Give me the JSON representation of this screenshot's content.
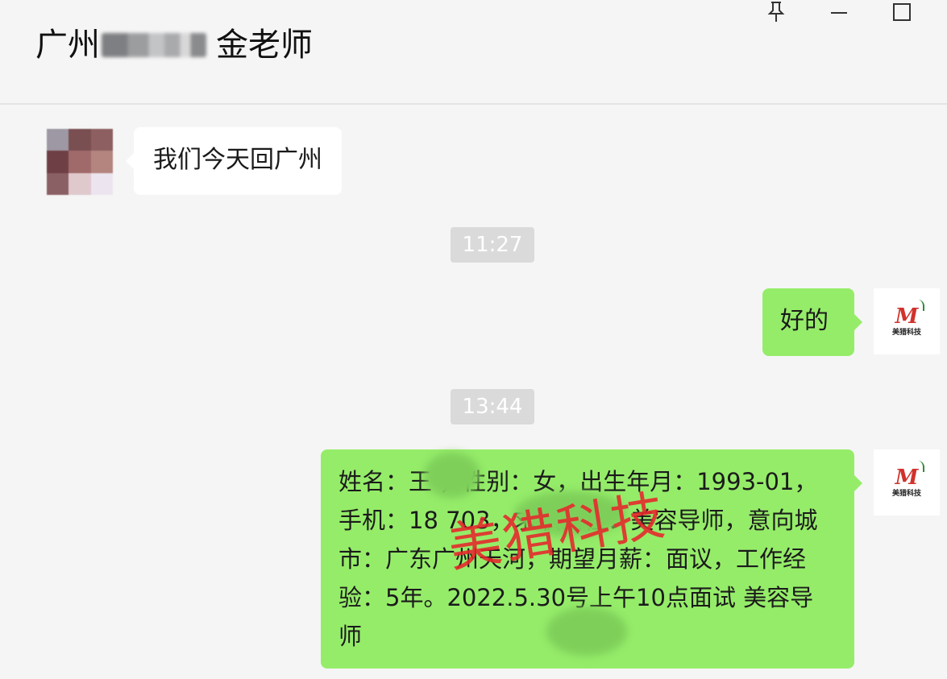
{
  "window": {
    "title_prefix": "广州",
    "title_suffix": "金老师",
    "pin_icon": "pin-icon",
    "minimize_icon": "minimize-icon",
    "maximize_icon": "maximize-icon"
  },
  "messages": [
    {
      "side": "left",
      "text": "我们今天回广州"
    },
    {
      "type": "time",
      "text": "11:27"
    },
    {
      "side": "right",
      "text": "好的"
    },
    {
      "type": "time",
      "text": "13:44"
    },
    {
      "side": "right",
      "text": "姓名：王 ，性别：女，出生年月：1993-01，手机：18 703，求职岗位：美容导师，意向城市：广东广州天河，期望月薪：面议，工作经验：5年。2022.5.30号上午10点面试 美容导师"
    }
  ],
  "self_avatar": {
    "logo_mark": "M",
    "logo_text": "美猎科技"
  },
  "watermark": "美猎科技",
  "colors": {
    "self_bubble": "#95ec69",
    "other_bubble": "#ffffff",
    "background": "#f5f5f5",
    "time_chip": "#dadada",
    "watermark": "#e8262b"
  }
}
